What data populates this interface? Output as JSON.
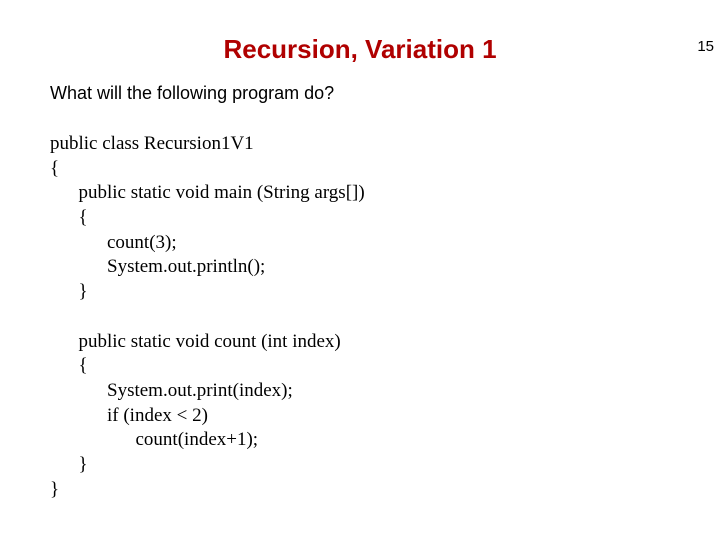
{
  "pageNumber": "15",
  "title": "Recursion, Variation 1",
  "question": "What will the following program do?",
  "code": {
    "l1": "public class Recursion1V1",
    "l2": "{",
    "l3": "      public static void main (String args[])",
    "l4": "      {",
    "l5": "            count(3);",
    "l6": "            System.out.println();",
    "l7": "      }",
    "l8": "",
    "l9": "      public static void count (int index)",
    "l10": "      {",
    "l11": "            System.out.print(index);",
    "l12": "            if (index < 2)",
    "l13": "                  count(index+1);",
    "l14": "      }",
    "l15": "}"
  }
}
